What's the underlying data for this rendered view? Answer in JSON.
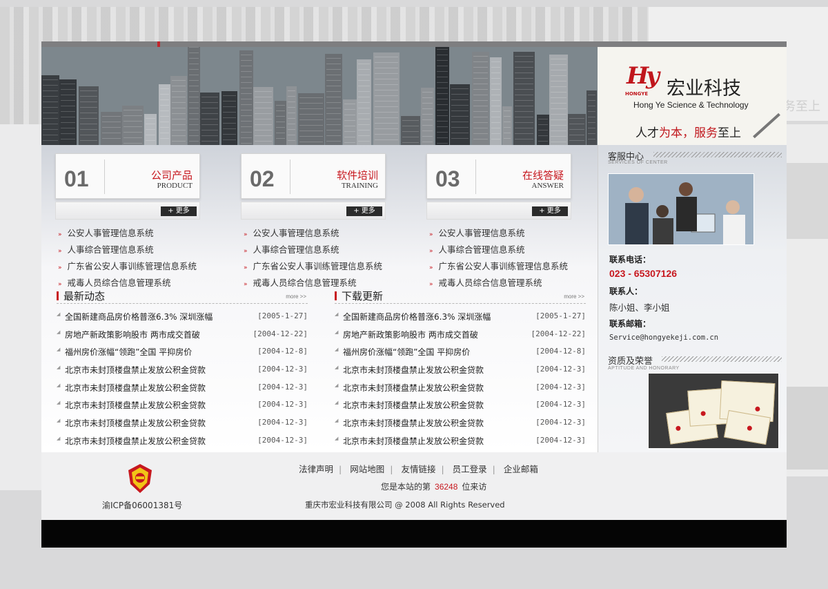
{
  "brand": {
    "logo": "Hy",
    "logo_sub": "HONGYE",
    "name": "宏业科技",
    "name_en": "Hong Ye Science & Technology",
    "slogan_a": "人才",
    "slogan_b": "为本，",
    "slogan_c": "服务",
    "slogan_d": "至上"
  },
  "categories": [
    {
      "num": "01",
      "zh": "公司产品",
      "en": "PRODUCT",
      "more": "+ 更多",
      "items": [
        "公安人事管理信息系统",
        "人事综合管理信息系统",
        "广东省公安人事训练管理信息系统",
        "戒毒人员综合信息管理系统"
      ]
    },
    {
      "num": "02",
      "zh": "软件培训",
      "en": "TRAINING",
      "more": "+ 更多",
      "items": [
        "公安人事管理信息系统",
        "人事综合管理信息系统",
        "广东省公安人事训练管理信息系统",
        "戒毒人员综合信息管理系统"
      ]
    },
    {
      "num": "03",
      "zh": "在线答疑",
      "en": "ANSWER",
      "more": "+ 更多",
      "items": [
        "公安人事管理信息系统",
        "人事综合管理信息系统",
        "广东省公安人事训练管理信息系统",
        "戒毒人员综合信息管理系统"
      ]
    }
  ],
  "news": [
    {
      "title": "最新动态",
      "more": "more >>",
      "rows": [
        {
          "t": "全国新建商品房价格普涨6.3% 深圳涨幅",
          "d": "[2005-1-27]"
        },
        {
          "t": "房地产新政策影响股市 两市成交首破",
          "d": "[2004-12-22]"
        },
        {
          "t": "福州房价涨幅“领跑”全国  平抑房价",
          "d": "[2004-12-8]"
        },
        {
          "t": "北京市未封顶楼盘禁止发放公积金贷款",
          "d": "[2004-12-3]"
        },
        {
          "t": "北京市未封顶楼盘禁止发放公积金贷款",
          "d": "[2004-12-3]"
        },
        {
          "t": "北京市未封顶楼盘禁止发放公积金贷款",
          "d": "[2004-12-3]"
        },
        {
          "t": "北京市未封顶楼盘禁止发放公积金贷款",
          "d": "[2004-12-3]"
        },
        {
          "t": "北京市未封顶楼盘禁止发放公积金贷款",
          "d": "[2004-12-3]"
        }
      ]
    },
    {
      "title": "下载更新",
      "more": "more >>",
      "rows": [
        {
          "t": "全国新建商品房价格普涨6.3% 深圳涨幅",
          "d": "[2005-1-27]"
        },
        {
          "t": "房地产新政策影响股市 两市成交首破",
          "d": "[2004-12-22]"
        },
        {
          "t": "福州房价涨幅“领跑”全国  平抑房价",
          "d": "[2004-12-8]"
        },
        {
          "t": "北京市未封顶楼盘禁止发放公积金贷款",
          "d": "[2004-12-3]"
        },
        {
          "t": "北京市未封顶楼盘禁止发放公积金贷款",
          "d": "[2004-12-3]"
        },
        {
          "t": "北京市未封顶楼盘禁止发放公积金贷款",
          "d": "[2004-12-3]"
        },
        {
          "t": "北京市未封顶楼盘禁止发放公积金贷款",
          "d": "[2004-12-3]"
        },
        {
          "t": "北京市未封顶楼盘禁止发放公积金贷款",
          "d": "[2004-12-3]"
        }
      ]
    }
  ],
  "sidebar": {
    "service_title": "客服中心",
    "service_en": "SERVICES OF CENTER",
    "phone_label": "联系电话：",
    "phone": "023 - 65307126",
    "contact_label": "联系人：",
    "contact": "陈小姐、李小姐",
    "email_label": "联系邮箱：",
    "email": "Service@hongyekeji.com.cn",
    "honor_title": "资质及荣誉",
    "honor_en": "APTITUDE AND HONORARY"
  },
  "footer": {
    "links": [
      "法律声明",
      "网站地图",
      "友情链接",
      "员工登录",
      "企业邮箱"
    ],
    "visit_prefix": "您是本站的第",
    "visit_count": "36248",
    "visit_suffix": "位来访",
    "icp": "渝ICP备06001381号",
    "copyright": "重庆市宏业科技有限公司 @ 2008 All Rights Reserved"
  },
  "colors": {
    "accent": "#c7181f",
    "footer_bar": "#050505"
  },
  "icons": {
    "emblem": "police-emblem-icon",
    "bullet": "chevron-right-icon"
  }
}
